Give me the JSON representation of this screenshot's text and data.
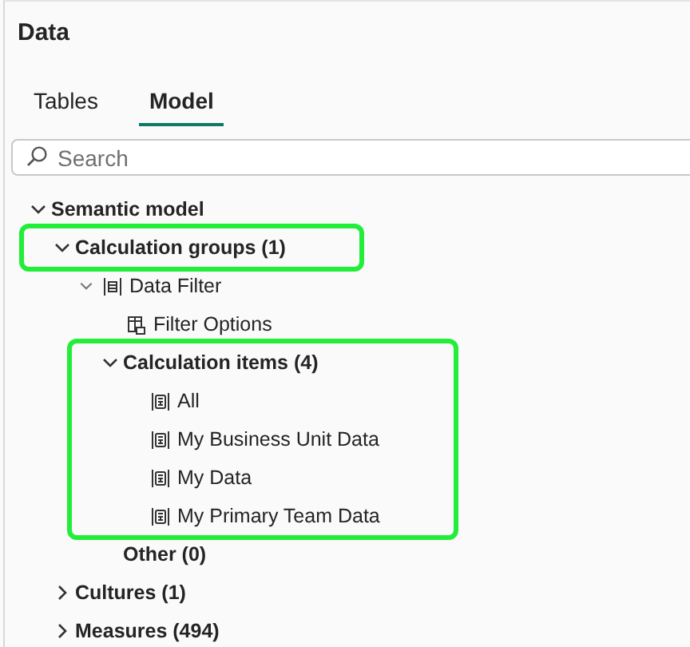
{
  "panel": {
    "title": "Data"
  },
  "tabs": [
    {
      "label": "Tables",
      "selected": false
    },
    {
      "label": "Model",
      "selected": true
    }
  ],
  "search": {
    "placeholder": "Search"
  },
  "tree": [
    {
      "label": "Semantic model",
      "expanded": true,
      "children": [
        {
          "label": "Calculation groups (1)",
          "expanded": true,
          "highlighted": true,
          "children": [
            {
              "label": "Data Filter",
              "expanded": true,
              "kind": "table",
              "children": [
                {
                  "label": "Filter Options",
                  "kind": "column"
                },
                {
                  "label": "Calculation items (4)",
                  "expanded": true,
                  "highlighted": true,
                  "children_highlighted": true,
                  "children": [
                    {
                      "label": "All",
                      "kind": "calc"
                    },
                    {
                      "label": "My Business Unit Data",
                      "kind": "calc"
                    },
                    {
                      "label": "My Data",
                      "kind": "calc"
                    },
                    {
                      "label": "My Primary Team Data",
                      "kind": "calc"
                    }
                  ]
                },
                {
                  "label": "Other (0)"
                }
              ]
            }
          ]
        },
        {
          "label": "Cultures (1)",
          "expanded": false
        },
        {
          "label": "Measures (494)",
          "expanded": false
        }
      ]
    }
  ]
}
